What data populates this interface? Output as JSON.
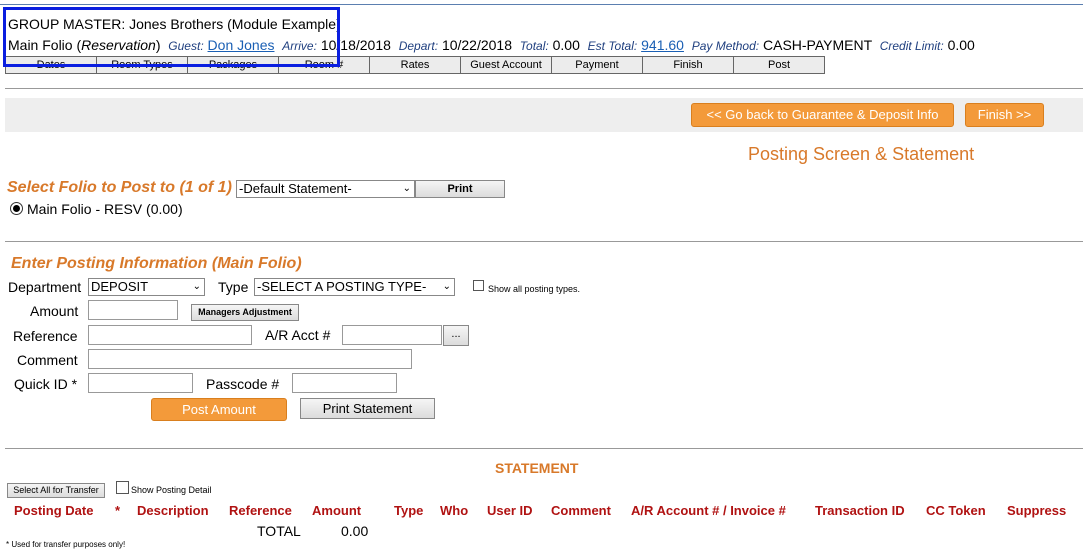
{
  "header": {
    "group_label": "GROUP MASTER:",
    "group_name": "Jones Brothers (Module Example)",
    "folio_prefix": "Main Folio (",
    "folio_type": "Reservation",
    "folio_suffix": ")",
    "guest_label": "Guest:",
    "guest_name": "Don Jones",
    "arrive_label": "Arrive:",
    "arrive_value": "10/18/2018",
    "depart_label": "Depart:",
    "depart_value": "10/22/2018",
    "total_label": "Total:",
    "total_value": "0.00",
    "est_total_label": "Est Total:",
    "est_total_value": "941.60",
    "pay_method_label": "Pay Method:",
    "pay_method_value": "CASH-PAYMENT",
    "credit_limit_label": "Credit Limit:",
    "credit_limit_value": "0.00"
  },
  "tabs": [
    "Dates",
    "Room Types",
    "Packages",
    "Room #",
    "Rates",
    "Guest Account",
    "Payment",
    "Finish",
    "Post"
  ],
  "nav": {
    "back_label": "<< Go back to Guarantee & Deposit Info",
    "finish_label": "Finish >>"
  },
  "page_title": "Posting Screen & Statement",
  "folio_select": {
    "heading": "Select Folio to Post to (1 of 1)",
    "statement_value": "-Default Statement-",
    "print_label": "Print",
    "radio_label": "Main Folio - RESV (0.00)"
  },
  "posting": {
    "heading": "Enter Posting Information (Main Folio)",
    "department_label": "Department",
    "department_value": "DEPOSIT",
    "type_label": "Type",
    "type_value": "-SELECT A POSTING TYPE-",
    "show_all_label": "Show all posting types.",
    "amount_label": "Amount",
    "managers_adj_label": "Managers Adjustment",
    "reference_label": "Reference",
    "ar_acct_label": "A/R Acct #",
    "ellipsis_label": "...",
    "comment_label": "Comment",
    "quick_id_label": "Quick ID *",
    "passcode_label": "Passcode #",
    "post_amount_label": "Post Amount",
    "print_statement_label": "Print Statement"
  },
  "statement": {
    "heading": "STATEMENT",
    "select_all_label": "Select All for Transfer",
    "show_detail_label": "Show Posting Detail",
    "columns": [
      "Posting Date",
      "*",
      "Description",
      "Reference",
      "Amount",
      "Type",
      "Who",
      "User ID",
      "Comment",
      "A/R Account # / Invoice #",
      "Transaction ID",
      "CC Token",
      "Suppress"
    ],
    "total_label": "TOTAL",
    "total_value": "0.00",
    "footnote": "* Used for transfer purposes only!"
  }
}
